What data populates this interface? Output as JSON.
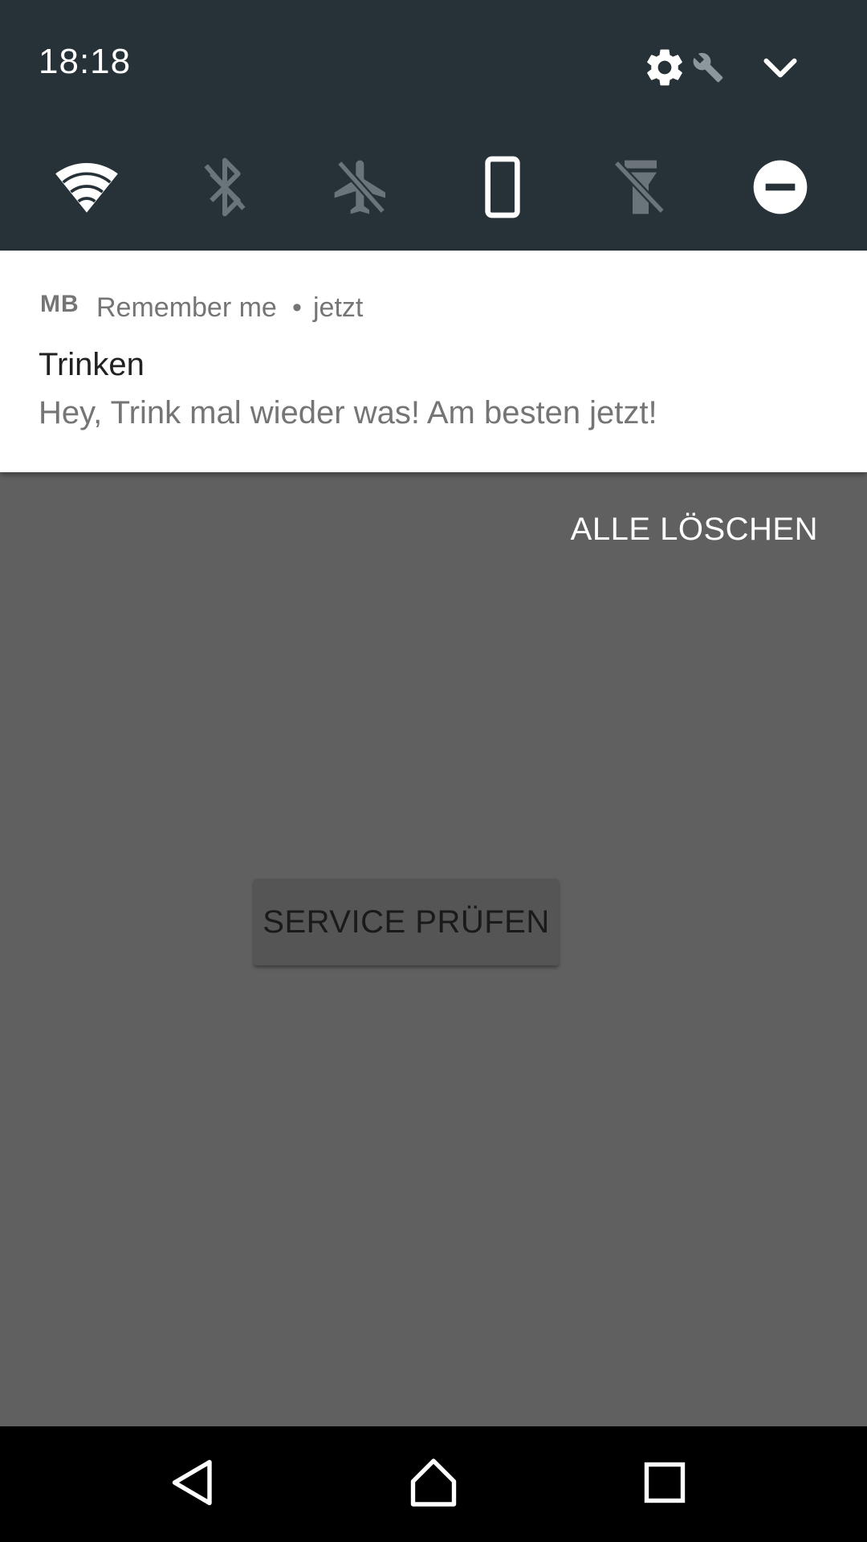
{
  "status": {
    "time": "18:18"
  },
  "quick_settings": {
    "tiles": [
      {
        "icon": "wifi-icon",
        "state": "on"
      },
      {
        "icon": "bluetooth-off-icon",
        "state": "off"
      },
      {
        "icon": "airplane-mode-off-icon",
        "state": "off"
      },
      {
        "icon": "screen-rotation-icon",
        "state": "on"
      },
      {
        "icon": "flashlight-off-icon",
        "state": "off"
      },
      {
        "icon": "do-not-disturb-icon",
        "state": "on"
      }
    ],
    "header_icons": [
      "settings-icon",
      "wrench-icon",
      "chevron-down-icon"
    ]
  },
  "notification": {
    "app_icon_text": "MB",
    "app_name": "Remember me",
    "separator": "•",
    "time": "jetzt",
    "title": "Trinken",
    "text": "Hey, Trink mal wieder was! Am besten jetzt!"
  },
  "shade": {
    "clear_all_label": "ALLE LÖSCHEN"
  },
  "app": {
    "service_button_label": "SERVICE PRÜFEN"
  },
  "nav": {
    "buttons": [
      "back-icon",
      "home-icon",
      "recents-icon"
    ]
  },
  "colors": {
    "qs_background": "#263238",
    "dim_background": "#606060",
    "icon_on": "#ffffff",
    "icon_off": "#6b7479"
  }
}
